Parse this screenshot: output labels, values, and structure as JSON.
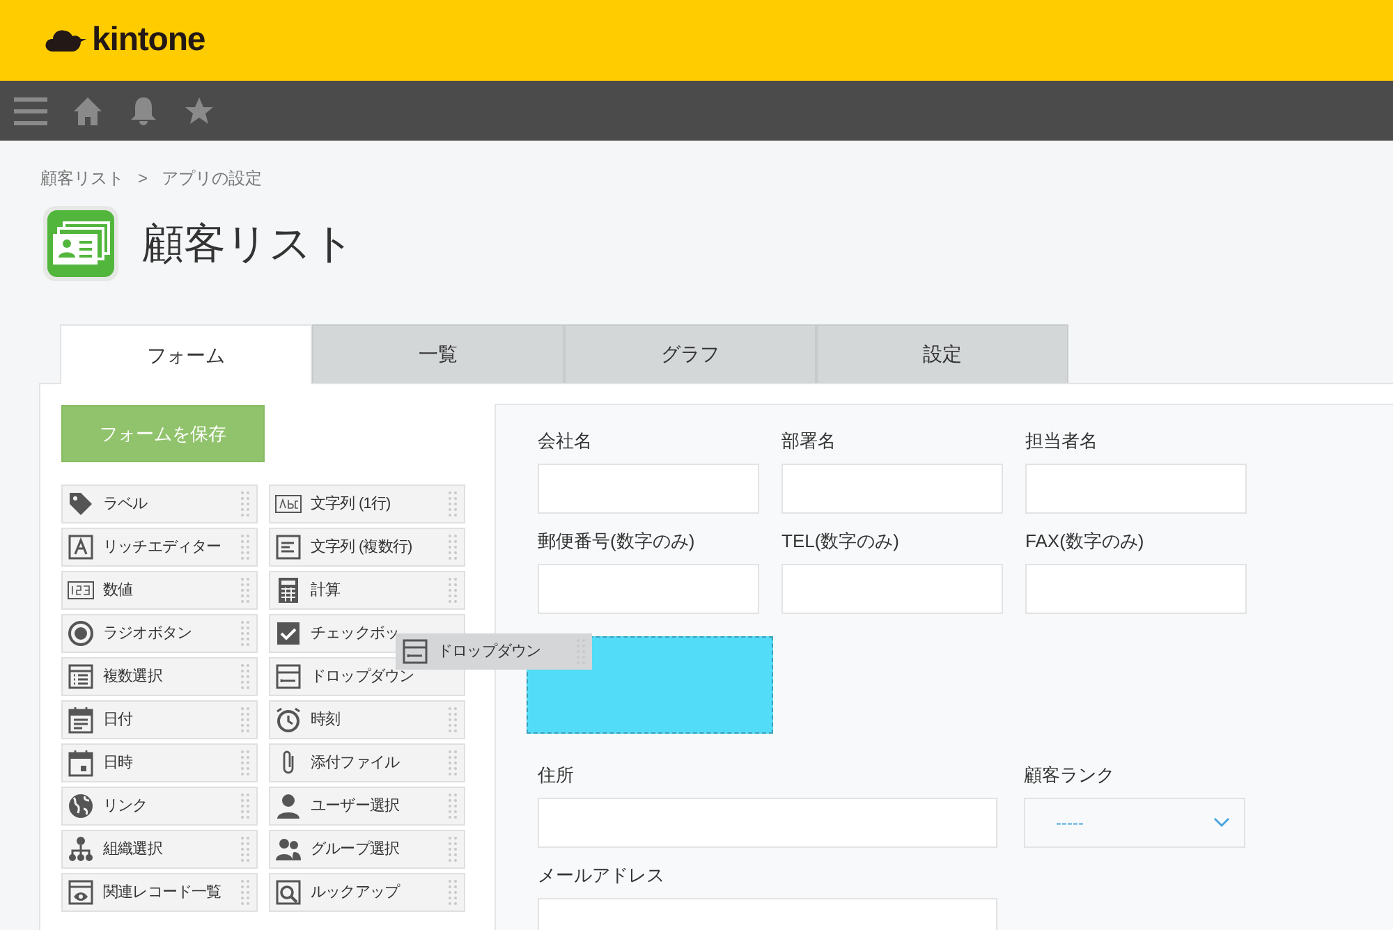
{
  "header": {
    "logo": "kintone"
  },
  "breadcrumb": [
    "顧客リスト",
    "アプリの設定"
  ],
  "breadcrumb_separator": ">",
  "app_title": "顧客リスト",
  "tabs": [
    {
      "label": "フォーム",
      "selected": true
    },
    {
      "label": "一覧",
      "selected": false
    },
    {
      "label": "グラフ",
      "selected": false
    },
    {
      "label": "設定",
      "selected": false
    }
  ],
  "save_button": "フォームを保存",
  "palette": [
    {
      "label": "ラベル",
      "kind": "tag"
    },
    {
      "label": "文字列 (1行)",
      "kind": "abc"
    },
    {
      "label": "リッチエディター",
      "kind": "richtext"
    },
    {
      "label": "文字列 (複数行)",
      "kind": "multiline"
    },
    {
      "label": "数値",
      "kind": "number"
    },
    {
      "label": "計算",
      "kind": "calc"
    },
    {
      "label": "ラジオボタン",
      "kind": "radio"
    },
    {
      "label": "チェックボッ",
      "kind": "checkbox"
    },
    {
      "label": "複数選択",
      "kind": "list"
    },
    {
      "label": "ドロップダウン",
      "kind": "dropdown"
    },
    {
      "label": "日付",
      "kind": "date"
    },
    {
      "label": "時刻",
      "kind": "clock"
    },
    {
      "label": "日時",
      "kind": "datetime"
    },
    {
      "label": "添付ファイル",
      "kind": "clip"
    },
    {
      "label": "リンク",
      "kind": "globe"
    },
    {
      "label": "ユーザー選択",
      "kind": "user"
    },
    {
      "label": "組織選択",
      "kind": "org"
    },
    {
      "label": "グループ選択",
      "kind": "group"
    },
    {
      "label": "関連レコード一覧",
      "kind": "related"
    },
    {
      "label": "ルックアップ",
      "kind": "lookup"
    }
  ],
  "dragging": {
    "label": "ドロップダウン",
    "kind": "dropdown"
  },
  "form_rows": [
    [
      {
        "label": "会社名",
        "kind": "text"
      },
      {
        "label": "部署名",
        "kind": "text"
      },
      {
        "label": "担当者名",
        "kind": "text"
      }
    ],
    [
      {
        "label": "郵便番号(数字のみ)",
        "kind": "text"
      },
      {
        "label": "TEL(数字のみ)",
        "kind": "text"
      },
      {
        "label": "FAX(数字のみ)",
        "kind": "text"
      }
    ],
    [
      {
        "kind": "drop_target"
      }
    ],
    [
      {
        "label": "住所",
        "kind": "wide"
      },
      {
        "label": "顧客ランク",
        "kind": "select",
        "value": "-----"
      }
    ],
    [
      {
        "label": "メールアドレス",
        "kind": "wide"
      }
    ]
  ]
}
